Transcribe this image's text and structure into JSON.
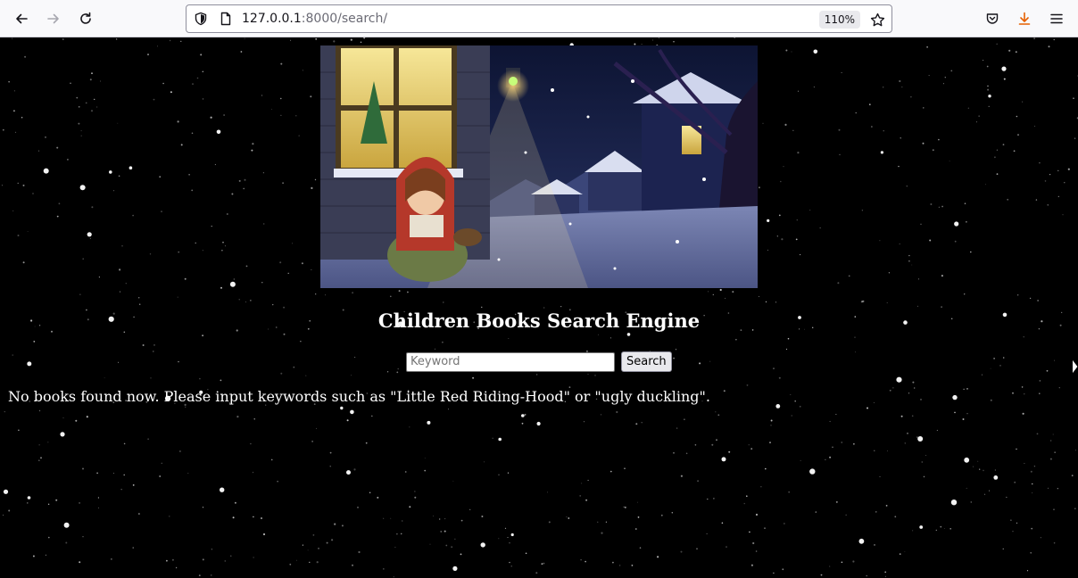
{
  "browser": {
    "url_host": "127.0.0.1",
    "url_rest": ":8000/search/",
    "zoom": "110%",
    "icons": [
      "back-arrow-icon",
      "forward-arrow-icon",
      "reload-icon",
      "shield-icon",
      "page-icon",
      "star-icon",
      "pocket-icon",
      "download-icon",
      "menu-icon"
    ]
  },
  "page": {
    "title": "Children Books Search Engine",
    "search": {
      "placeholder": "Keyword",
      "value": "",
      "button_label": "Search"
    },
    "message": "No books found now. Please input keywords such as \"Little Red Riding-Hood\" or \"ugly duckling\"."
  },
  "colors": {
    "background": "#000000",
    "text": "#ffffff",
    "download_accent": "#e66000"
  }
}
